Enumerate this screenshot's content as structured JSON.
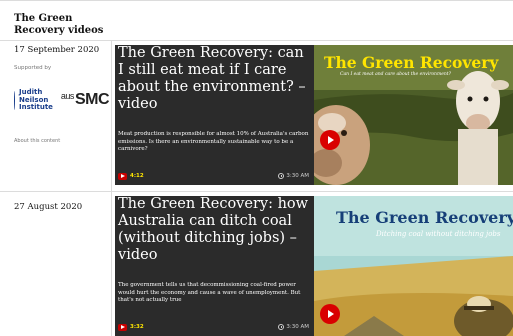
{
  "section": {
    "title": "The Green Recovery videos"
  },
  "items": [
    {
      "date": "17 September 2020",
      "supported_by": "Supported by",
      "sponsors": {
        "jni": "Judith Neilson Institute",
        "smc_prefix": "aus",
        "smc": "SMC"
      },
      "about": "About this content",
      "title": "The Green Recovery: can I still eat meat if I care about the environment? – video",
      "standfirst": "Meat production is responsible for almost 10% of Australia's carbon emissions. Is there an environmentally sustainable way to be a carnivore?",
      "duration": "4:12",
      "time": "3:30 AM",
      "thumbnail": {
        "title": "The Green Recovery",
        "subtitle": "Can I eat meat and care about the environment?",
        "play_icon": "play-icon"
      }
    },
    {
      "date": "27 August 2020",
      "title": "The Green Recovery: how Australia can ditch coal (without ditching jobs) – video",
      "standfirst": "The government tells us that decommissioning coal-fired power would hurt the economy and cause a wave of unemployment. But that's not actually true",
      "duration": "3:32",
      "time": "3:30 AM",
      "thumbnail": {
        "title": "The Green Recovery",
        "subtitle": "Ditching coal without ditching jobs",
        "play_icon": "play-icon"
      }
    }
  ],
  "colors": {
    "accent_red": "#c70000",
    "duration_yellow": "#ffe500",
    "card_bg": "#2b2b2b",
    "thumb1_title": "#ffe500",
    "thumb2_title": "#163f78"
  }
}
